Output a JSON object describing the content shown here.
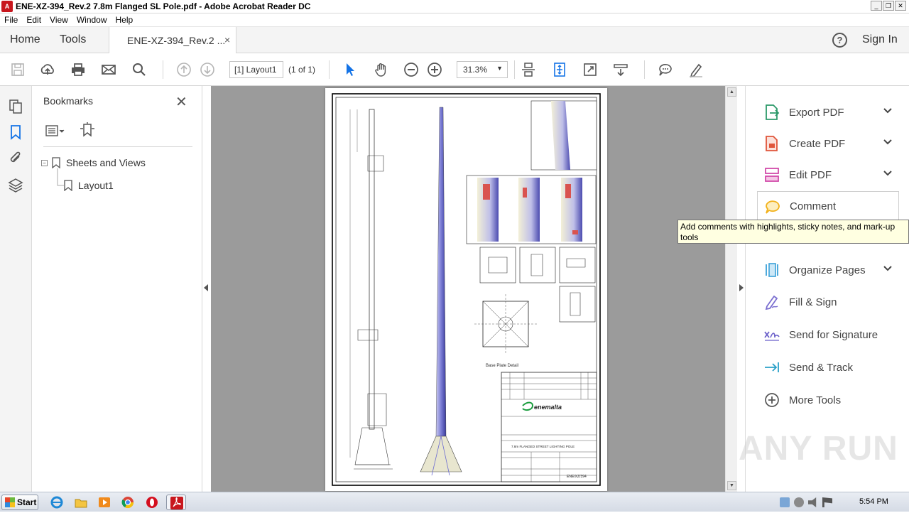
{
  "window": {
    "title": "ENE-XZ-394_Rev.2  7.8m Flanged SL Pole.pdf - Adobe Acrobat Reader DC",
    "app_icon": "acrobat-icon"
  },
  "menu": [
    "File",
    "Edit",
    "View",
    "Window",
    "Help"
  ],
  "nav": {
    "home": "Home",
    "tools": "Tools",
    "doc_tab": "ENE-XZ-394_Rev.2 ...",
    "tab_close": "×",
    "help": "?",
    "sign_in": "Sign In"
  },
  "toolbar": {
    "page_field": "[1] Layout1",
    "page_of": "(1 of 1)",
    "zoom": "31.3%",
    "icons": [
      "save-icon",
      "upload-icon",
      "print-icon",
      "email-icon",
      "search-icon",
      "prev-page-icon",
      "next-page-icon",
      "select-arrow-icon",
      "hand-icon",
      "zoom-out-icon",
      "zoom-in-icon",
      "scroll-mode-icon",
      "fit-page-icon",
      "fullscreen-icon",
      "read-mode-icon",
      "comment-icon",
      "pen-icon"
    ]
  },
  "left_strip": [
    "pages-icon",
    "bookmark-icon",
    "attachment-icon",
    "layers-icon"
  ],
  "bookmarks": {
    "title": "Bookmarks",
    "close": "✕",
    "root": "Sheets and Views",
    "root_expander": "−",
    "child": "Layout1"
  },
  "document": {
    "company": "enemalta",
    "drawing_title": "7.8m FLANGED STREET LIGHTING POLE",
    "drawing_number": "ENE/XZ/394",
    "base_plate_caption": "Base Plate Detail"
  },
  "right_pane": {
    "tools": [
      {
        "label": "Export PDF",
        "icon": "export-pdf-icon",
        "color": "#2d9a6a",
        "chevron": true
      },
      {
        "label": "Create PDF",
        "icon": "create-pdf-icon",
        "color": "#e0553b",
        "chevron": true
      },
      {
        "label": "Edit PDF",
        "icon": "edit-pdf-icon",
        "color": "#d24baa",
        "chevron": true
      },
      {
        "label": "Comment",
        "icon": "comment-tool-icon",
        "color": "#f2b21d",
        "chevron": false
      },
      {
        "label": "Organize Pages",
        "icon": "organize-pages-icon",
        "color": "#3ba1d9",
        "chevron": true
      },
      {
        "label": "Fill & Sign",
        "icon": "fill-sign-icon",
        "color": "#7b6fd0",
        "chevron": false
      },
      {
        "label": "Send for Signature",
        "icon": "send-signature-icon",
        "color": "#6a5fc9",
        "chevron": false
      },
      {
        "label": "Send & Track",
        "icon": "send-track-icon",
        "color": "#2aa0c8",
        "chevron": false
      },
      {
        "label": "More Tools",
        "icon": "more-tools-icon",
        "color": "#555555",
        "chevron": false
      }
    ],
    "tooltip": "Add comments with highlights, sticky notes, and mark-up tools"
  },
  "watermark": "ANY RUN",
  "taskbar": {
    "start": "Start",
    "apps": [
      "ie-icon",
      "explorer-icon",
      "media-player-icon",
      "chrome-icon",
      "opera-icon",
      "acrobat-icon"
    ],
    "clock": "5:54 PM"
  }
}
